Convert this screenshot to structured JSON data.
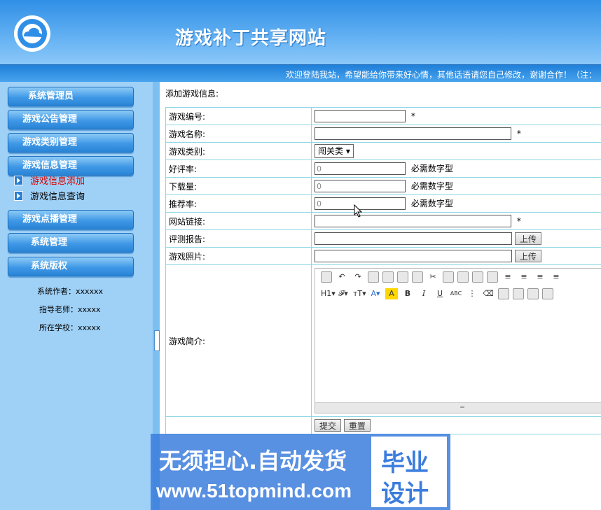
{
  "header": {
    "site_title": "游戏补丁共享网站",
    "marquee": "欢迎登陆我站，希望能给你带来好心情，其他话语请您自己修改，谢谢合作！（注："
  },
  "sidebar": {
    "menu": [
      {
        "label": "系统管理员"
      },
      {
        "label": "游戏公告管理"
      },
      {
        "label": "游戏类别管理"
      },
      {
        "label": "游戏信息管理"
      },
      {
        "label": "游戏点播管理"
      },
      {
        "label": "系统管理"
      },
      {
        "label": "系统版权"
      }
    ],
    "sub_items": [
      {
        "label": "游戏信息添加",
        "active": true
      },
      {
        "label": "游戏信息查询",
        "active": false
      }
    ],
    "info": [
      "系统作者：xxxxxx",
      "指导老师：xxxxx",
      "所在学校：xxxxx"
    ]
  },
  "form": {
    "heading": "添加游戏信息:",
    "fields": {
      "game_id": {
        "label": "游戏编号:",
        "required": "*"
      },
      "game_name": {
        "label": "游戏名称:",
        "required": "*"
      },
      "game_category": {
        "label": "游戏类别:",
        "selected": "闯关类"
      },
      "rating": {
        "label": "好评率:",
        "value": "0",
        "hint": "必需数字型"
      },
      "downloads": {
        "label": "下载量:",
        "value": "0",
        "hint": "必需数字型"
      },
      "recommend": {
        "label": "推荐率:",
        "value": "0",
        "hint": "必需数字型"
      },
      "website": {
        "label": "网站链接:",
        "required": "*"
      },
      "review": {
        "label": "评测报告:",
        "button": "上传"
      },
      "photo": {
        "label": "游戏照片:",
        "button": "上传"
      },
      "intro": {
        "label": "游戏简介:"
      }
    },
    "submit": "提交",
    "reset": "重置"
  },
  "watermark": {
    "line1": "无须担心.自动发货",
    "line2": "www.51topmind.com",
    "box_line1": "毕业",
    "box_line2": "设计"
  },
  "colors": {
    "header": "#2f8fe6",
    "sidebar": "#9fd0f6",
    "active_sub": "#d40000",
    "table_border": "#8ed6e6"
  }
}
